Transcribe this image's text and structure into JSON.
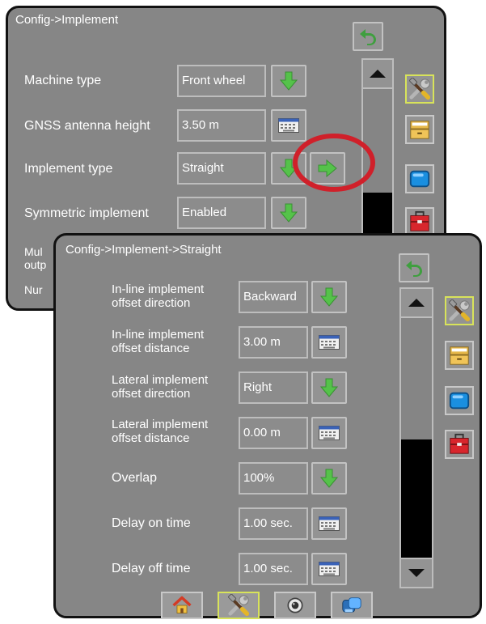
{
  "back_screen": {
    "title": "Config->Implement",
    "rows": [
      {
        "label": "Machine type",
        "value": "Front wheel",
        "control": "down-arrow-icon"
      },
      {
        "label": "GNSS antenna height",
        "value": "3.50 m",
        "control": "keyboard-icon"
      },
      {
        "label": "Implement type",
        "value": "Straight",
        "control": "down-arrow-icon"
      },
      {
        "label": "Symmetric implement",
        "value": "Enabled",
        "control": "down-arrow-icon"
      }
    ],
    "partial_labels": [
      "Mul",
      "outp",
      "Nur"
    ]
  },
  "front_screen": {
    "title": "Config->Implement->Straight",
    "rows": [
      {
        "label_1": "In-line implement",
        "label_2": "offset direction",
        "value": "Backward",
        "control": "down-arrow-icon"
      },
      {
        "label_1": "In-line implement",
        "label_2": "offset distance",
        "value": "3.00 m",
        "control": "keyboard-icon"
      },
      {
        "label_1": "Lateral implement",
        "label_2": "offset direction",
        "value": "Right",
        "control": "down-arrow-icon"
      },
      {
        "label_1": "Lateral implement",
        "label_2": "offset distance",
        "value": "0.00 m",
        "control": "keyboard-icon"
      },
      {
        "label": "Overlap",
        "value": "100%",
        "control": "down-arrow-icon"
      },
      {
        "label": "Delay on time",
        "value": "1.00 sec.",
        "control": "keyboard-icon"
      },
      {
        "label": "Delay off time",
        "value": "1.00 sec.",
        "control": "keyboard-icon"
      }
    ]
  },
  "side_tabs": [
    "tools-icon",
    "storage-drawer-icon",
    "display-icon",
    "toolbox-icon"
  ],
  "bottom_nav": [
    "home-icon",
    "tools-icon",
    "camera-icon",
    "data-transfer-icon"
  ],
  "colors": {
    "screen_bg": "#868686",
    "green_arrow": "#4bb84b",
    "highlight_circle": "#d0202a",
    "active_border": "#d8e35a",
    "back_arrow": "#3d9b3d"
  }
}
